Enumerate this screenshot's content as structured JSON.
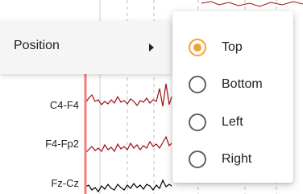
{
  "colors": {
    "accent": "#f6a032",
    "marker_line": "#f08080",
    "trace_red": "#a01010",
    "trace_black": "#000000"
  },
  "channels": [
    "C4-F4",
    "F4-Fp2",
    "Fz-Cz"
  ],
  "menu": {
    "position_label": "Position",
    "submenu_icon": "chevron-right-icon",
    "options": [
      {
        "label": "Top",
        "selected": true
      },
      {
        "label": "Bottom",
        "selected": false
      },
      {
        "label": "Left",
        "selected": false
      },
      {
        "label": "Right",
        "selected": false
      }
    ]
  }
}
